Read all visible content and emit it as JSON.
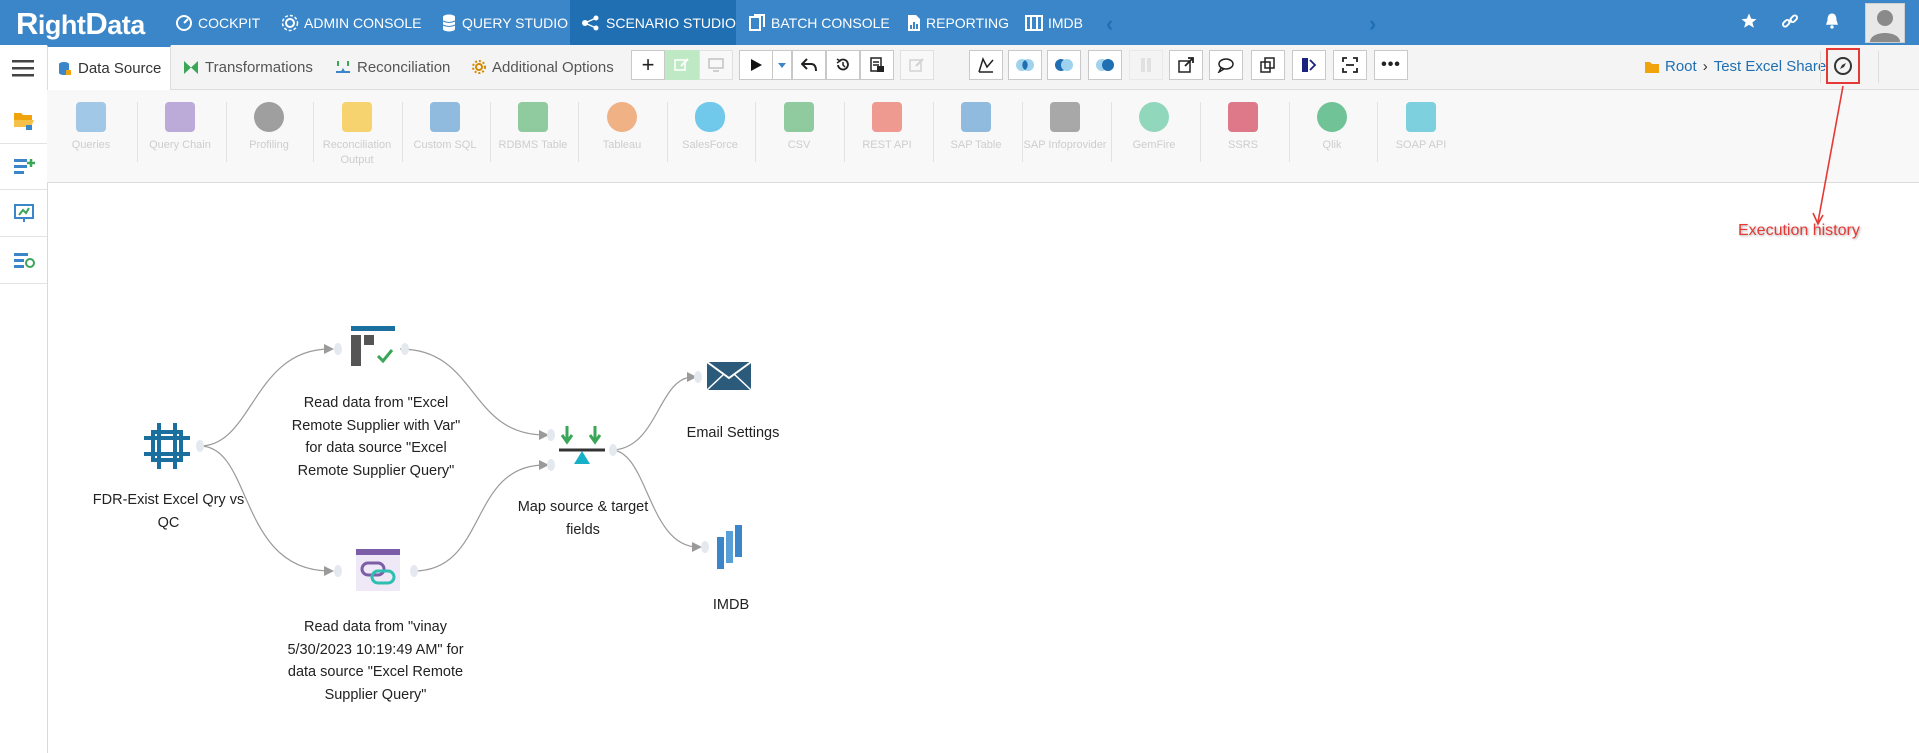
{
  "app": {
    "logo_text": "RightData"
  },
  "topnav": {
    "items": [
      {
        "label": "COCKPIT",
        "icon": "cockpit-icon"
      },
      {
        "label": "ADMIN CONSOLE",
        "icon": "gear-icon"
      },
      {
        "label": "QUERY STUDIO",
        "icon": "database-icon"
      },
      {
        "label": "SCENARIO STUDIO",
        "icon": "scenario-icon",
        "active": true
      },
      {
        "label": "BATCH CONSOLE",
        "icon": "batch-icon"
      },
      {
        "label": "REPORTING",
        "icon": "report-icon"
      },
      {
        "label": "IMDB",
        "icon": "imdb-icon"
      }
    ],
    "right_icons": [
      "star-icon",
      "link-icon",
      "bell-icon",
      "user-avatar"
    ]
  },
  "tabs": [
    {
      "label": "Data Source",
      "icon": "data-source-icon",
      "active": true
    },
    {
      "label": "Transformations",
      "icon": "transformations-icon"
    },
    {
      "label": "Reconciliation",
      "icon": "reconciliation-icon"
    },
    {
      "label": "Additional Options",
      "icon": "gear-icon"
    }
  ],
  "breadcrumb": {
    "root": "Root",
    "current": "Test Excel Sharepoint"
  },
  "palette": [
    {
      "label": "Queries",
      "color": "#5aa0d8"
    },
    {
      "label": "Query Chain",
      "color": "#8a6bbf"
    },
    {
      "label": "Profiling",
      "color": "#555555"
    },
    {
      "label": "Reconciliation Output",
      "color": "#f5b400"
    },
    {
      "label": "Custom SQL",
      "color": "#3a86c8"
    },
    {
      "label": "RDBMS Table",
      "color": "#3aa657"
    },
    {
      "label": "Tableau",
      "color": "#e97627"
    },
    {
      "label": "SalesForce",
      "color": "#00a1e0"
    },
    {
      "label": "CSV",
      "color": "#3aa657"
    },
    {
      "label": "REST API",
      "color": "#e84c3d"
    },
    {
      "label": "SAP Table",
      "color": "#3a86c8"
    },
    {
      "label": "SAP Infoprovider",
      "color": "#666666"
    },
    {
      "label": "GemFire",
      "color": "#3dbb8a"
    },
    {
      "label": "SSRS",
      "color": "#c8102e"
    },
    {
      "label": "Qlik",
      "color": "#009845"
    },
    {
      "label": "SOAP API",
      "color": "#17b0c8"
    }
  ],
  "flow": {
    "nodes": {
      "start": {
        "label": "FDR-Exist Excel Qry vs QC"
      },
      "read1": {
        "label": "Read data from \"Excel Remote Supplier with Var\" for data source \"Excel Remote Supplier Query\""
      },
      "read2": {
        "label": "Read data from \"vinay 5/30/2023 10:19:49 AM\" for data source \"Excel Remote Supplier Query\""
      },
      "map": {
        "label": "Map source & target fields"
      },
      "email": {
        "label": "Email Settings"
      },
      "imdb": {
        "label": "IMDB"
      }
    }
  },
  "annotation": {
    "label": "Execution history",
    "color": "#e53935"
  }
}
